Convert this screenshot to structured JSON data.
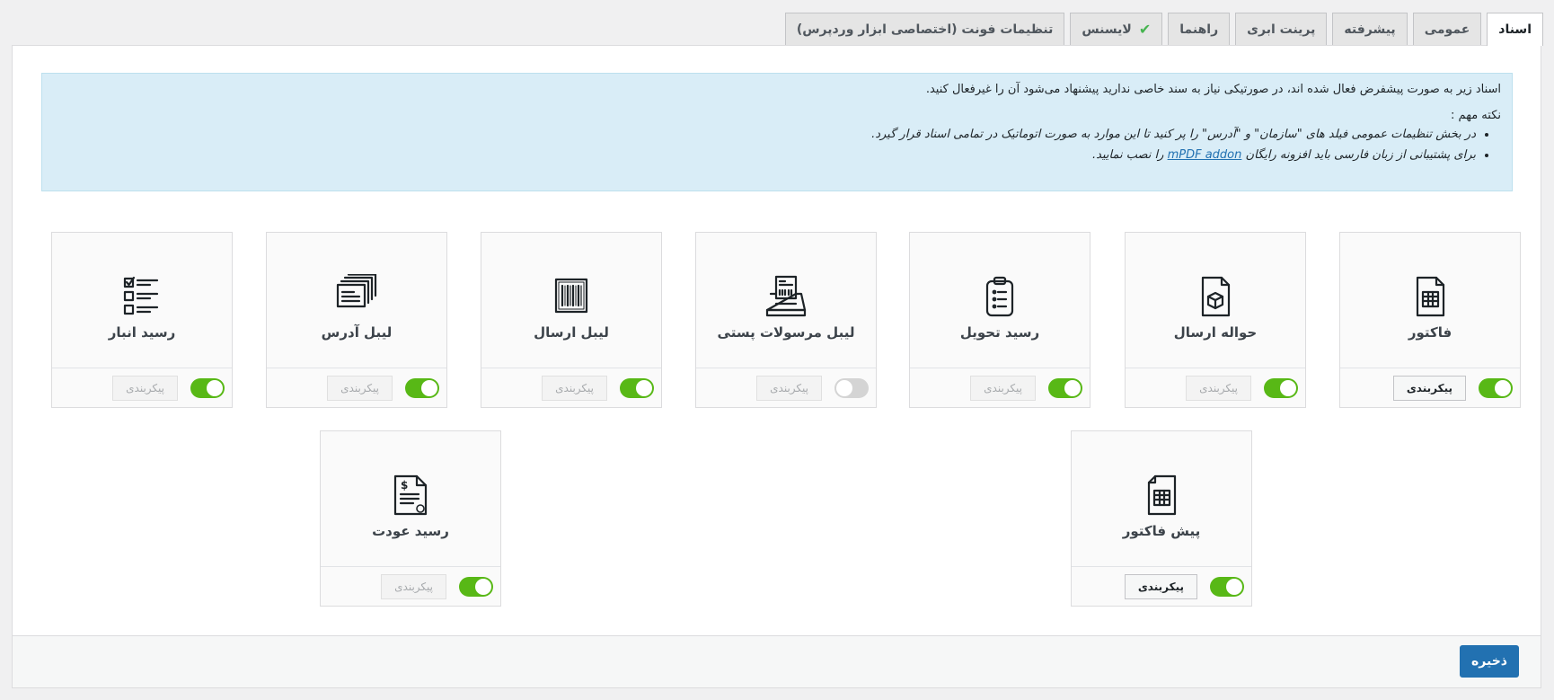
{
  "tabs": [
    {
      "label": "اسناد",
      "active": true
    },
    {
      "label": "عمومی"
    },
    {
      "label": "پیشرفته"
    },
    {
      "label": "پرینت ابری"
    },
    {
      "label": "راهنما"
    },
    {
      "label": "لایسنس",
      "check": "✔"
    },
    {
      "label": "تنظیمات فونت (اختصاصی ابزار وردپرس)"
    }
  ],
  "notice": {
    "intro": "اسناد زیر به صورت پیشفرض فعال شده اند، در صورتیکی نیاز به سند خاصی ندارید پیشنهاد می‌شود آن را غیرفعال کنید.",
    "note_title": "نکته مهم :",
    "bullet1": "در بخش تنظیمات عمومی فیلد های \"سازمان\" و \"آدرس\" را پر کنید تا این موارد به صورت اتوماتیک در تمامی اسناد قرار گیرد.",
    "bullet2_before": "برای پشتیبانی از زبان فارسی باید افزونه رایگان",
    "bullet2_link": "mPDF addon",
    "bullet2_after": "را نصب نمایید."
  },
  "documents": [
    {
      "title": "فاکتور",
      "icon": "invoice-icon",
      "enabled": true,
      "config_label": "پیکربندی",
      "config_active": true
    },
    {
      "title": "حواله ارسال",
      "icon": "package-slip-icon",
      "enabled": true,
      "config_label": "پیکربندی",
      "config_active": false
    },
    {
      "title": "رسید تحویل",
      "icon": "clipboard-icon",
      "enabled": true,
      "config_label": "پیکربندی",
      "config_active": false
    },
    {
      "title": "لیبل مرسولات پستی",
      "icon": "label-printer-icon",
      "enabled": false,
      "config_label": "پیکربندی",
      "config_active": false
    },
    {
      "title": "لیبل ارسال",
      "icon": "barcode-icon",
      "enabled": true,
      "config_label": "پیکربندی",
      "config_active": false
    },
    {
      "title": "لیبل آدرس",
      "icon": "stacked-labels-icon",
      "enabled": true,
      "config_label": "پیکربندی",
      "config_active": false
    },
    {
      "title": "رسید انبار",
      "icon": "checklist-icon",
      "enabled": true,
      "config_label": "پیکربندی",
      "config_active": false
    },
    {
      "title": "پیش فاکتور",
      "icon": "proforma-icon",
      "enabled": true,
      "config_label": "پیکربندی",
      "config_active": true
    },
    {
      "title": "رسید عودت",
      "icon": "refund-receipt-icon",
      "enabled": true,
      "config_label": "پیکربندی",
      "config_active": false
    }
  ],
  "footer": {
    "save_label": "ذخیره"
  },
  "colors": {
    "toggle_on": "#58b816",
    "toggle_off": "#d4d4d4",
    "primary": "#2271b1",
    "notice_bg": "#d9edf7"
  }
}
